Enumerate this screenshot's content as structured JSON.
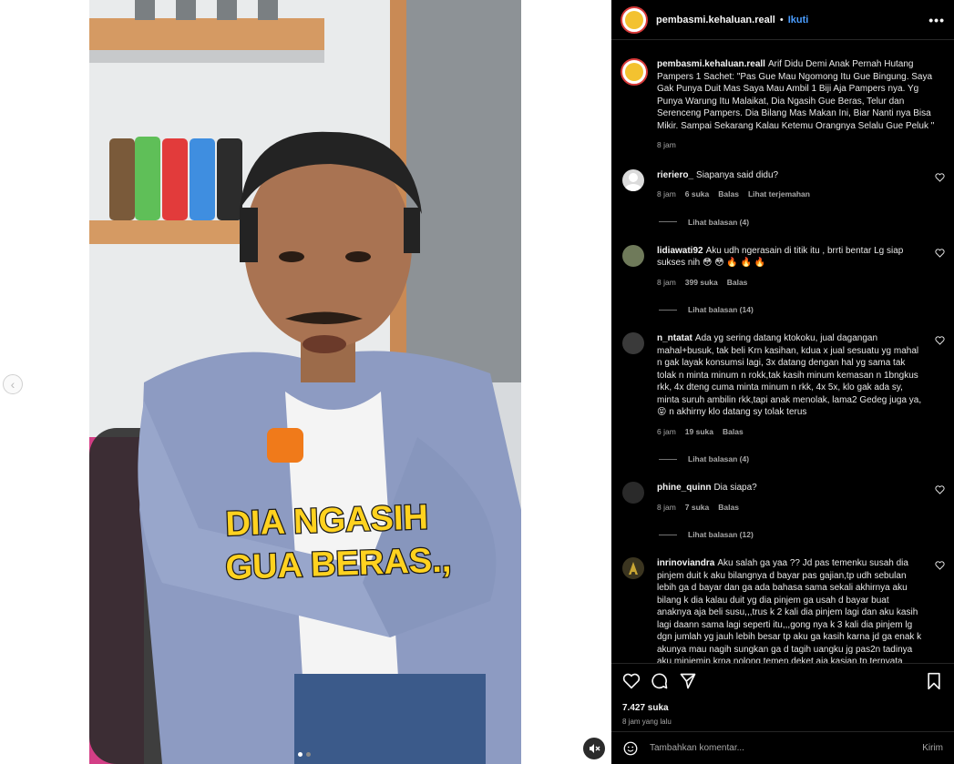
{
  "post": {
    "username": "pembasmi.kehaluan.reall",
    "separator": "•",
    "follow_label": "Ikuti",
    "more_label": "•••"
  },
  "video": {
    "overlay_line1": "DIA NGASIH",
    "overlay_line2": "GUA BERAS.,"
  },
  "caption": {
    "username": "pembasmi.kehaluan.reall",
    "text": "Arif Didu Demi Anak Pernah Hutang Pampers 1 Sachet: \"Pas Gue Mau Ngomong Itu Gue Bingung. Saya Gak Punya Duit Mas Saya Mau Ambil 1 Biji Aja Pampers nya. Yg Punya Warung Itu Malaikat, Dia Ngasih Gue Beras, Telur dan Serenceng Pampers. Dia Bilang Mas Makan Ini, Biar Nanti nya Bisa Mikir. Sampai Sekarang Kalau Ketemu Orangnya Selalu Gue Peluk \"",
    "time": "8 jam"
  },
  "comments": [
    {
      "username": "rieriero_",
      "text": "Siapanya said didu?",
      "time": "8 jam",
      "likes": "6 suka",
      "reply": "Balas",
      "extra": "Lihat terjemahan",
      "view_replies": "Lihat balasan (4)",
      "avatar_color": "#dbdbdb"
    },
    {
      "username": "lidiawati92",
      "text": "Aku udh ngerasain di titik itu , brrti bentar Lg siap sukses nih 😳 😳 🔥 🔥 🔥",
      "time": "8 jam",
      "likes": "399 suka",
      "reply": "Balas",
      "extra": "",
      "view_replies": "Lihat balasan (14)",
      "avatar_color": "#6f7a5a"
    },
    {
      "username": "n_ntatat",
      "text": "Ada yg sering datang ktokoku, jual dagangan mahal+busuk, tak beli Krn kasihan, kdua x jual sesuatu yg mahal n gak layak konsumsi lagi, 3x datang dengan hal yg sama tak tolak n minta minum n rokk,tak kasih minum kemasan n 1bngkus rkk, 4x dteng cuma minta minum n rkk, 4x 5x, klo gak ada sy, minta suruh ambilin rkk,tapi anak menolak, lama2 Gedeg juga ya,😝 n akhirny klo datang sy tolak terus",
      "time": "6 jam",
      "likes": "19 suka",
      "reply": "Balas",
      "extra": "",
      "view_replies": "Lihat balasan (4)",
      "avatar_color": "#3a3a3a"
    },
    {
      "username": "phine_quinn",
      "text": "Dia siapa?",
      "time": "8 jam",
      "likes": "7 suka",
      "reply": "Balas",
      "extra": "",
      "view_replies": "Lihat balasan (12)",
      "avatar_color": "#2a2a2a"
    },
    {
      "username": "inrinoviandra",
      "text": "Aku salah ga yaa ?? Jd pas temenku susah dia pinjem duit k aku bilangnya d bayar pas gajian,tp udh sebulan lebih ga d bayar dan ga ada bahasa sama sekali akhirnya aku bilang k dia kalau duit yg dia pinjem ga usah d bayar buat anaknya aja beli susu,,,trus k 2 kali dia pinjem lagi dan aku kasih lagi daann sama lagi seperti itu,,,gong nya k 3 kali dia pinjem lg dgn jumlah yg jauh lebih besar tp aku ga kasih karna jd ga enak k akunya mau nagih sungkan ga d tagih uangku jg pas2n tadinya aku minjemin krna nolong temen deket aja kasian tp ternyata begitu,, akhirnya aku kasih lowongan kerja buat suami dia berapa lowker aku kasih tp selalu d tolak sama",
      "time": "",
      "likes": "",
      "reply": "",
      "extra": "",
      "view_replies": "",
      "avatar_color": "#3b3520"
    }
  ],
  "footer": {
    "likes": "7.427 suka",
    "time": "8 jam yang lalu",
    "comment_placeholder": "Tambahkan komentar...",
    "post_label": "Kirim"
  },
  "colors": {
    "accent_link": "#4a9dff",
    "background": "#000000",
    "overlay_text": "#ffd21f"
  }
}
